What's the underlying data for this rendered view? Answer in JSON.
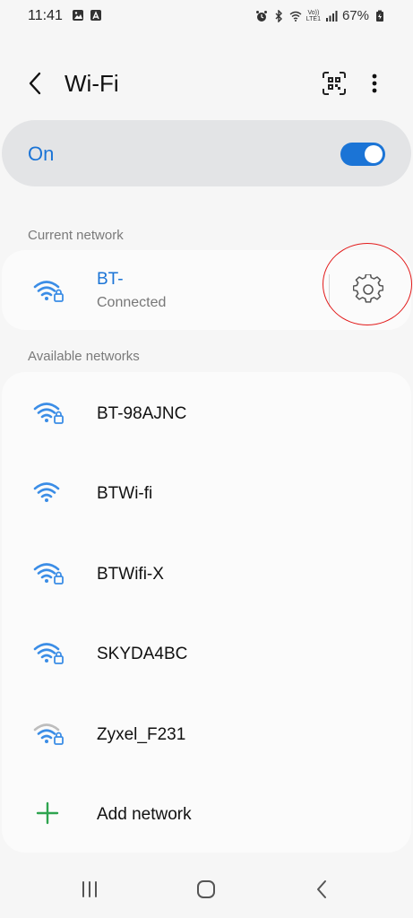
{
  "status_bar": {
    "time": "11:41",
    "battery": "67%",
    "volte_top": "Vo))",
    "volte_bottom": "LTE1"
  },
  "app_bar": {
    "title": "Wi-Fi"
  },
  "wifi_toggle": {
    "label": "On",
    "enabled": true,
    "color": "#1b74d6"
  },
  "current_network": {
    "section_label": "Current network",
    "name": "BT-",
    "status": "Connected"
  },
  "available_networks": {
    "section_label": "Available networks",
    "items": [
      {
        "name": "BT-98AJNC",
        "secured": true,
        "signal": "strong"
      },
      {
        "name": "BTWi-fi",
        "secured": false,
        "signal": "strong"
      },
      {
        "name": "BTWifi-X",
        "secured": true,
        "signal": "strong"
      },
      {
        "name": "SKYDA4BC",
        "secured": true,
        "signal": "strong"
      },
      {
        "name": "Zyxel_F231",
        "secured": true,
        "signal": "weak"
      }
    ],
    "add_label": "Add network"
  },
  "colors": {
    "accent": "#1b74d6",
    "wifi_icon": "#3b8de6",
    "wifi_weak": "#bdbdbd",
    "add_icon": "#2ea44f",
    "annotation": "#e21a1a"
  }
}
